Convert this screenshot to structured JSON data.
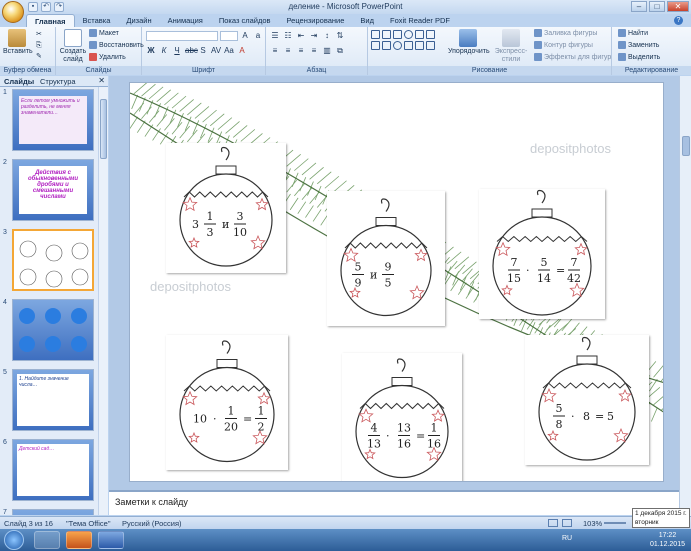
{
  "window": {
    "title": "деление - Microsoft PowerPoint",
    "buttons": [
      "–",
      "□",
      "✕"
    ]
  },
  "ribbon_tabs": [
    "Главная",
    "Вставка",
    "Дизайн",
    "Анимация",
    "Показ слайдов",
    "Рецензирование",
    "Вид",
    "Foxit Reader PDF"
  ],
  "groups": {
    "clipboard": {
      "label": "Буфер обмена",
      "paste": "Вставить"
    },
    "slides": {
      "label": "Слайды",
      "create": "Создать слайд",
      "layout": "Макет",
      "reset": "Восстановить",
      "delete": "Удалить"
    },
    "font": {
      "label": "Шрифт"
    },
    "paragraph": {
      "label": "Абзац"
    },
    "drawing": {
      "label": "Рисование",
      "arrange": "Упорядочить",
      "quickstyles": "Экспресс-стили",
      "fill": "Заливка фигуры",
      "outline": "Контур фигуры",
      "effects": "Эффекты для фигур"
    },
    "editing": {
      "label": "Редактирование",
      "find": "Найти",
      "replace": "Заменить",
      "select": "Выделить"
    }
  },
  "panel_tabs": [
    "Слайды",
    "Структура"
  ],
  "thumbnails": [
    {
      "num": "1",
      "text": "Если летом умножить и разделить, не меняя знаменатели…"
    },
    {
      "num": "2",
      "text": "Действия с обыкновенными дробями и смешанными числами"
    },
    {
      "num": "3",
      "text": ""
    },
    {
      "num": "4",
      "text": ""
    },
    {
      "num": "5",
      "text": "1. Найдите значение числа…"
    },
    {
      "num": "6",
      "text": "Детский сад…"
    },
    {
      "num": "7",
      "text": ""
    }
  ],
  "slide": {
    "watermark": "depositphotos",
    "cards": [
      {
        "expr": "3 1/3 и 3/10"
      },
      {
        "expr": "5/9 и 9/5"
      },
      {
        "expr": "7/15 · 5/14 = 7/42"
      },
      {
        "expr": "10 · 1/20 = 1/2"
      },
      {
        "expr": "4/13 · 13/16 = 1/16"
      },
      {
        "expr": "5/8 · 8 = 5"
      }
    ]
  },
  "notes_placeholder": "Заметки к слайду",
  "status": {
    "slide": "Слайд 3 из 16",
    "theme": "\"Тема Office\"",
    "lang": "Русский (Россия)",
    "zoom": "103%"
  },
  "tooltip": {
    "line1": "1 декабря 2015 г.",
    "line2": "вторник"
  },
  "clock": {
    "time": "17:22",
    "date": "01.12.2015",
    "lang": "RU"
  },
  "colors": {
    "accent": "#f4a736",
    "ribbon": "#dce8f6",
    "taskbar": "#2d5d97"
  }
}
